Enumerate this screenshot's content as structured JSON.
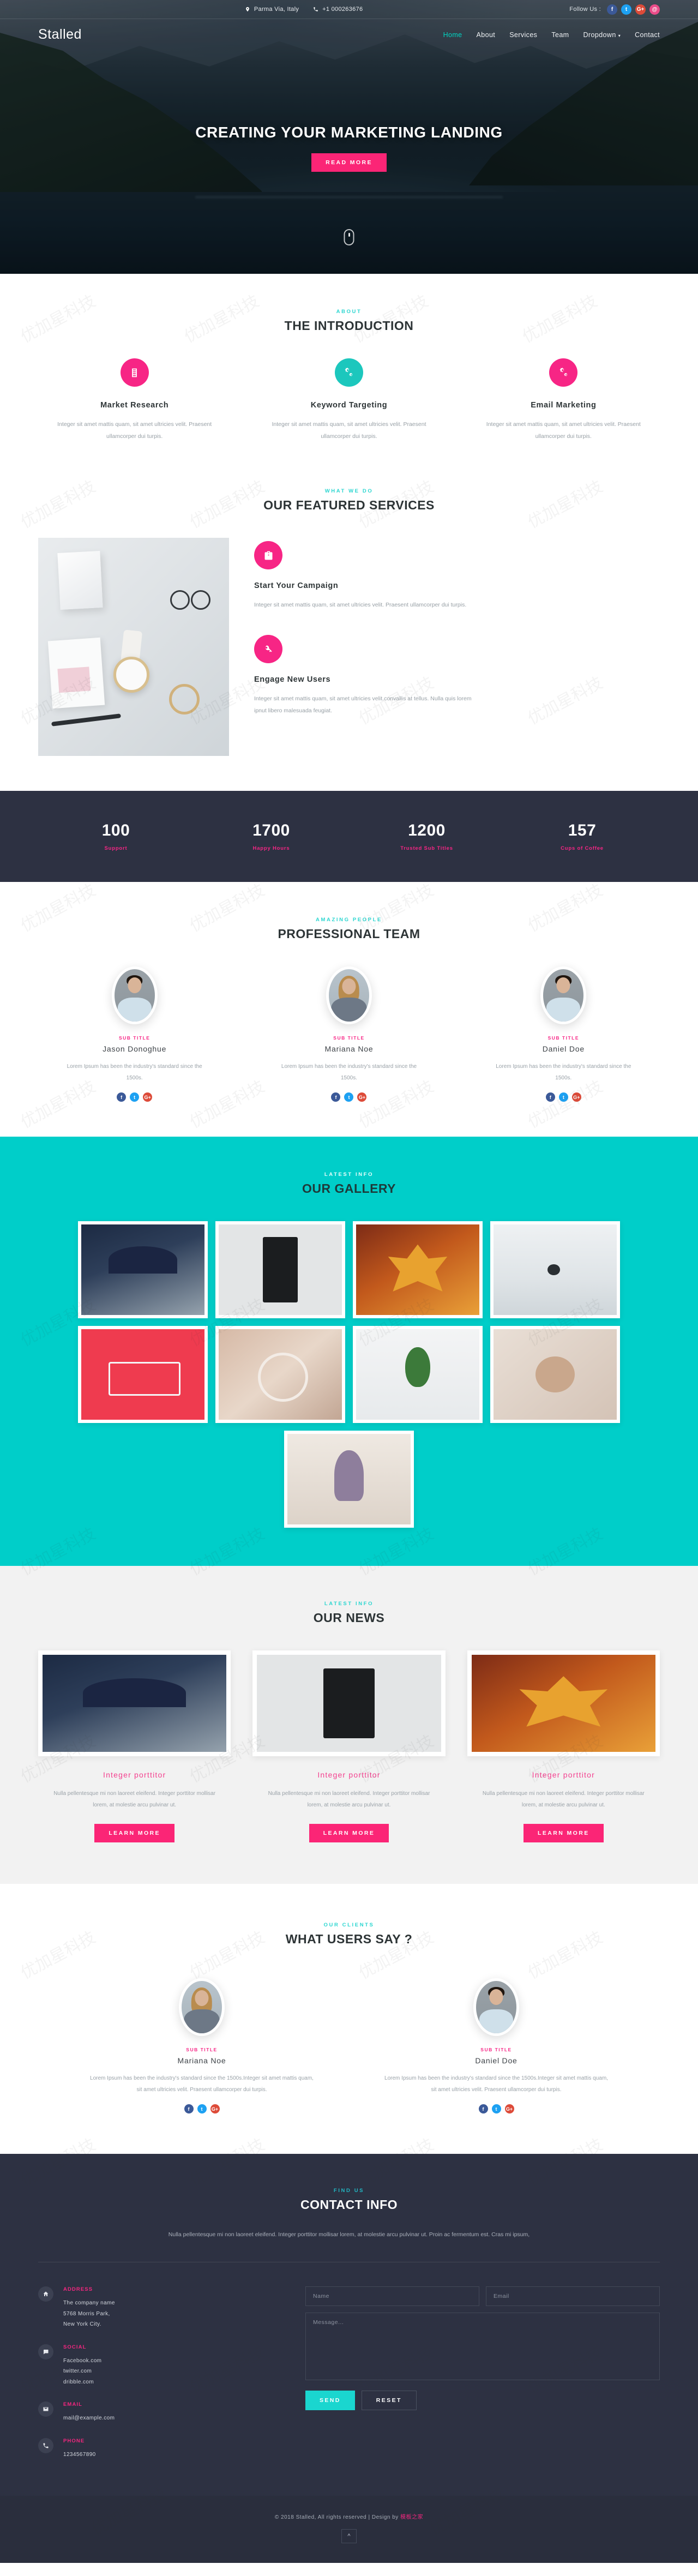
{
  "topbar": {
    "location": "Parma Via, Italy",
    "phone": "+1 000263676",
    "follow_label": "Follow Us :",
    "socials": [
      "f",
      "t",
      "G+",
      "@"
    ]
  },
  "nav": {
    "logo": "Stalled",
    "items": [
      {
        "label": "Home",
        "active": true
      },
      {
        "label": "About",
        "active": false
      },
      {
        "label": "Services",
        "active": false
      },
      {
        "label": "Team",
        "active": false
      },
      {
        "label": "Dropdown",
        "active": false,
        "caret": true
      },
      {
        "label": "Contact",
        "active": false
      }
    ]
  },
  "hero": {
    "title": "CREATING YOUR MARKETING LANDING",
    "cta": "READ MORE"
  },
  "intro": {
    "subtitle": "ABOUT",
    "title": "THE INTRODUCTION",
    "cards": [
      {
        "icon": "chart-bar-icon",
        "color": "#f72585",
        "title": "Market Research",
        "text": "Integer sit amet mattis quam, sit amet ultricies velit. Praesent ullamcorper dui turpis."
      },
      {
        "icon": "cogs-icon",
        "color": "#1cc7bd",
        "title": "Keyword Targeting",
        "text": "Integer sit amet mattis quam, sit amet ultricies velit. Praesent ullamcorper dui turpis."
      },
      {
        "icon": "cogs-icon",
        "color": "#f72585",
        "title": "Email Marketing",
        "text": "Integer sit amet mattis quam, sit amet ultricies velit. Praesent ullamcorper dui turpis."
      }
    ]
  },
  "services": {
    "subtitle": "WHAT WE DO",
    "title": "OUR FEATURED SERVICES",
    "items": [
      {
        "icon": "briefcase-icon",
        "title": "Start Your Campaign",
        "text": "Integer sit amet mattis quam, sit amet ultricies velit. Praesent ullamcorper dui turpis."
      },
      {
        "icon": "key-icon",
        "title": "Engage New Users",
        "text": "Integer sit amet mattis quam, sit amet ultricies velit.convallis at tellus. Nulla quis lorem ipnut libero malesuada feugiat."
      }
    ]
  },
  "counters": [
    {
      "number": "100",
      "label": "Support"
    },
    {
      "number": "1700",
      "label": "Happy Hours"
    },
    {
      "number": "1200",
      "label": "Trusted Sub Titles"
    },
    {
      "number": "157",
      "label": "Cups of Coffee"
    }
  ],
  "team": {
    "subtitle": "AMAZING PEOPLE",
    "title": "PROFESSIONAL TEAM",
    "members": [
      {
        "sub": "SUB TITLE",
        "name": "Jason Donoghue",
        "text": "Lorem Ipsum has been the industry's standard since the 1500s.",
        "gender": "m"
      },
      {
        "sub": "SUB TITLE",
        "name": "Mariana Noe",
        "text": "Lorem Ipsum has been the industry's standard since the 1500s.",
        "gender": "f"
      },
      {
        "sub": "SUB TITLE",
        "name": "Daniel Doe",
        "text": "Lorem Ipsum has been the industry's standard since the 1500s.",
        "gender": "m"
      }
    ],
    "socials": [
      "f",
      "t",
      "G+"
    ]
  },
  "gallery": {
    "subtitle": "LATEST INFO",
    "title": "OUR GALLERY",
    "accent": "#00cec9",
    "items": [
      "umbrella-photo",
      "camera-photo",
      "autumn-leaf-photo",
      "bird-photo",
      "red-bicycle-photo",
      "ring-photo",
      "plant-photo",
      "hands-photo",
      "flowers-photo"
    ]
  },
  "news": {
    "subtitle": "LATEST INFO",
    "title": "OUR NEWS",
    "cards": [
      {
        "image": "umbrella-photo",
        "title": "Integer porttitor",
        "text": "Nulla pellentesque mi non laoreet eleifend. Integer porttitor mollisar lorem, at molestie arcu pulvinar ut.",
        "cta": "LEARN MORE"
      },
      {
        "image": "camera-photo",
        "title": "Integer porttitor",
        "text": "Nulla pellentesque mi non laoreet eleifend. Integer porttitor mollisar lorem, at molestie arcu pulvinar ut.",
        "cta": "LEARN MORE"
      },
      {
        "image": "autumn-leaf-photo",
        "title": "Integer porttitor",
        "text": "Nulla pellentesque mi non laoreet eleifend. Integer porttitor mollisar lorem, at molestie arcu pulvinar ut.",
        "cta": "LEARN MORE"
      }
    ]
  },
  "testimonials": {
    "subtitle": "OUR CLIENTS",
    "title": "WHAT USERS SAY ?",
    "items": [
      {
        "sub": "SUB TITLE",
        "name": "Mariana Noe",
        "text": "Lorem Ipsum has been the industry's standard since the 1500s.Integer sit amet mattis quam, sit amet ultricies velit. Praesent ullamcorper dui turpis.",
        "gender": "f"
      },
      {
        "sub": "SUB TITLE",
        "name": "Daniel Doe",
        "text": "Lorem Ipsum has been the industry's standard since the 1500s.Integer sit amet mattis quam, sit amet ultricies velit. Praesent ullamcorper dui turpis.",
        "gender": "m"
      }
    ],
    "socials": [
      "f",
      "t",
      "G+"
    ]
  },
  "contact": {
    "subtitle": "FIND US",
    "title": "CONTACT INFO",
    "lead": "Nulla pellentesque mi non laoreet eleifend. Integer porttitor mollisar lorem, at molestie arcu pulvinar ut. Proin ac fermentum est. Cras mi ipsum,",
    "blocks": [
      {
        "icon": "home-icon",
        "heading": "ADDRESS",
        "lines": [
          "The company name",
          "5768 Morris Park,",
          "New York City."
        ]
      },
      {
        "icon": "comment-icon",
        "heading": "SOCIAL",
        "lines": [
          "Facebook.com",
          "twitter.com",
          "dribble.com"
        ]
      },
      {
        "icon": "envelope-icon",
        "heading": "EMAIL",
        "lines": [
          "mail@example.com"
        ]
      },
      {
        "icon": "phone-icon",
        "heading": "PHONE",
        "lines": [
          "1234567890"
        ]
      }
    ],
    "form": {
      "name_placeholder": "Name",
      "email_placeholder": "Email",
      "message_placeholder": "Message...",
      "send_label": "SEND",
      "reset_label": "RESET"
    }
  },
  "footer": {
    "copyright": "© 2018 Stalled, All rights reserved | Design by ",
    "designer": "模板之家",
    "to_top_icon": "chevron-up-icon"
  },
  "colors": {
    "pink": "#f72585",
    "teal": "#00cec9",
    "dark": "#2d3142"
  }
}
